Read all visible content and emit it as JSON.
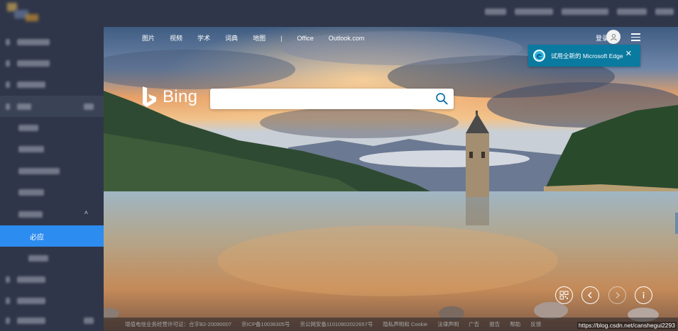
{
  "bing_nav": {
    "items": [
      "图片",
      "视频",
      "学术",
      "词典",
      "地图"
    ],
    "separator": "|",
    "office": "Office",
    "outlook": "Outlook.com"
  },
  "header": {
    "login": "登录"
  },
  "edge_banner": {
    "text": "试用全新的 Microsoft Edge",
    "close": "✕"
  },
  "bing": {
    "logo_text": "Bing",
    "search_value": ""
  },
  "sidebar": {
    "selected_label": "必应",
    "expand_chevron": "˄"
  },
  "controls": {
    "qr": "qr-code-icon",
    "prev": "chevron-left-icon",
    "next": "chevron-right-icon",
    "info": "info-icon"
  },
  "footer": {
    "items": [
      "增值电信业务经营许可证：合字B2-20090007",
      "京ICP备10036305号",
      "京公网安备11010802022657号",
      "隐私声明和 Cookie",
      "法律声明",
      "广告",
      "报告",
      "帮助",
      "反馈"
    ],
    "watermark": "https://blog.csdn.net/canshegui2293"
  },
  "colors": {
    "sidebar_bg": "#2f3649",
    "selected": "#2d8cf0",
    "edge_banner": "#0a7aa0"
  }
}
